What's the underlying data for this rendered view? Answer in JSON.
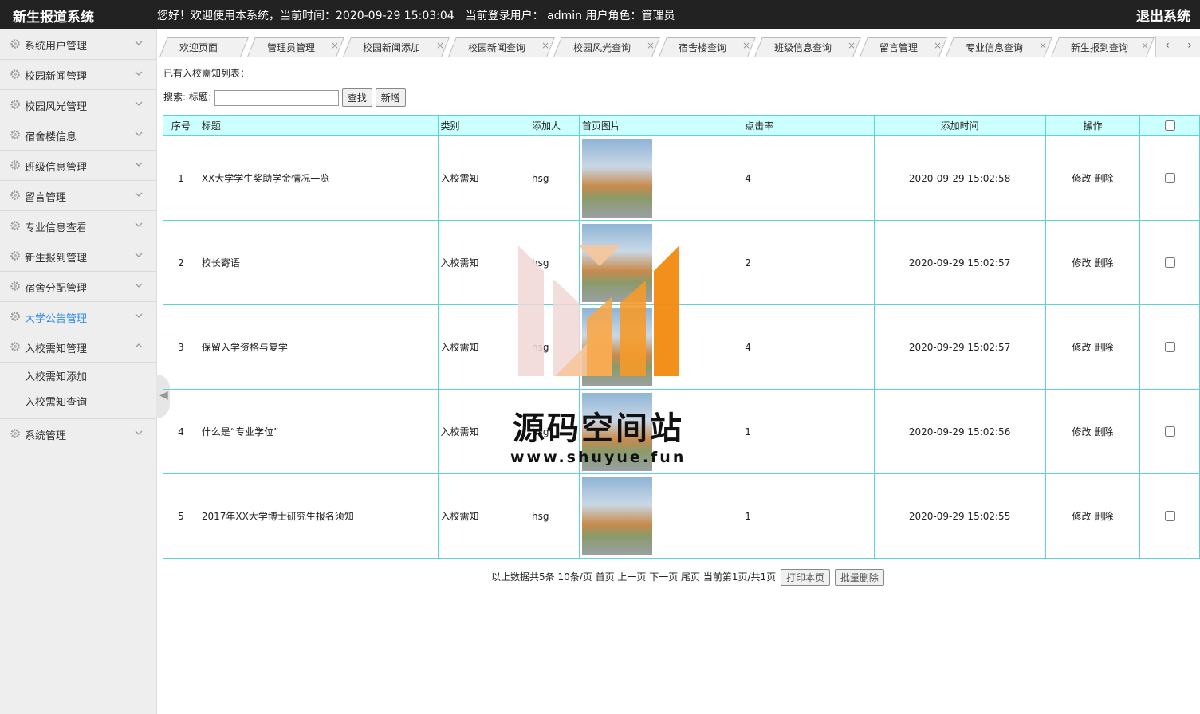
{
  "header": {
    "brand": "新生报道系统",
    "welcome": "您好！欢迎使用本系统，当前时间：2020-09-29 15:03:04　当前登录用户： admin  用户角色：管理员",
    "logout": "退出系统"
  },
  "sidebar": {
    "items": [
      {
        "label": "系统用户管理"
      },
      {
        "label": "校园新闻管理"
      },
      {
        "label": "校园风光管理"
      },
      {
        "label": "宿舍楼信息"
      },
      {
        "label": "班级信息管理"
      },
      {
        "label": "留言管理"
      },
      {
        "label": "专业信息查看"
      },
      {
        "label": "新生报到管理"
      },
      {
        "label": "宿舍分配管理"
      },
      {
        "label": "大学公告管理"
      },
      {
        "label": "入校需知管理"
      },
      {
        "label": "系统管理"
      }
    ],
    "sub_items": [
      "入校需知添加",
      "入校需知查询"
    ],
    "active_color": "#2d8cf0"
  },
  "tabs": [
    "欢迎页面",
    "管理员管理",
    "校园新闻添加",
    "校园新闻查询",
    "校园风光查询",
    "宿舍楼查询",
    "班级信息查询",
    "留言管理",
    "专业信息查询",
    "新生报到查询"
  ],
  "content": {
    "list_title": "已有入校需知列表：",
    "search_label": "搜索: 标题:",
    "search_value": "",
    "search_button": "查找",
    "add_button": "新增"
  },
  "table": {
    "headers": [
      "序号",
      "标题",
      "类别",
      "添加人",
      "首页图片",
      "点击率",
      "添加时间",
      "操作"
    ],
    "rows": [
      {
        "no": "1",
        "title": "XX大学学生奖助学金情况一览",
        "category": "入校需知",
        "author": "hsg",
        "clicks": "4",
        "time": "2020-09-29 15:02:58",
        "edit": "修改",
        "delete": "删除"
      },
      {
        "no": "2",
        "title": "校长寄语",
        "category": "入校需知",
        "author": "hsg",
        "clicks": "2",
        "time": "2020-09-29 15:02:57",
        "edit": "修改",
        "delete": "删除"
      },
      {
        "no": "3",
        "title": "保留入学资格与复学",
        "category": "入校需知",
        "author": "hsg",
        "clicks": "4",
        "time": "2020-09-29 15:02:57",
        "edit": "修改",
        "delete": "删除"
      },
      {
        "no": "4",
        "title": "什么是“专业学位”",
        "category": "入校需知",
        "author": "hsg",
        "clicks": "1",
        "time": "2020-09-29 15:02:56",
        "edit": "修改",
        "delete": "删除"
      },
      {
        "no": "5",
        "title": "2017年XX大学博士研究生报名须知",
        "category": "入校需知",
        "author": "hsg",
        "clicks": "1",
        "time": "2020-09-29 15:02:55",
        "edit": "修改",
        "delete": "删除"
      }
    ]
  },
  "pager": {
    "summary": "以上数据共5条  10条/页 首页 上一页 下一页 尾页 当前第1页/共1页",
    "print_button": "打印本页",
    "batch_delete_button": "批量删除"
  },
  "watermark": {
    "text": "源码空间站",
    "url": "www.shuyue.fun"
  }
}
